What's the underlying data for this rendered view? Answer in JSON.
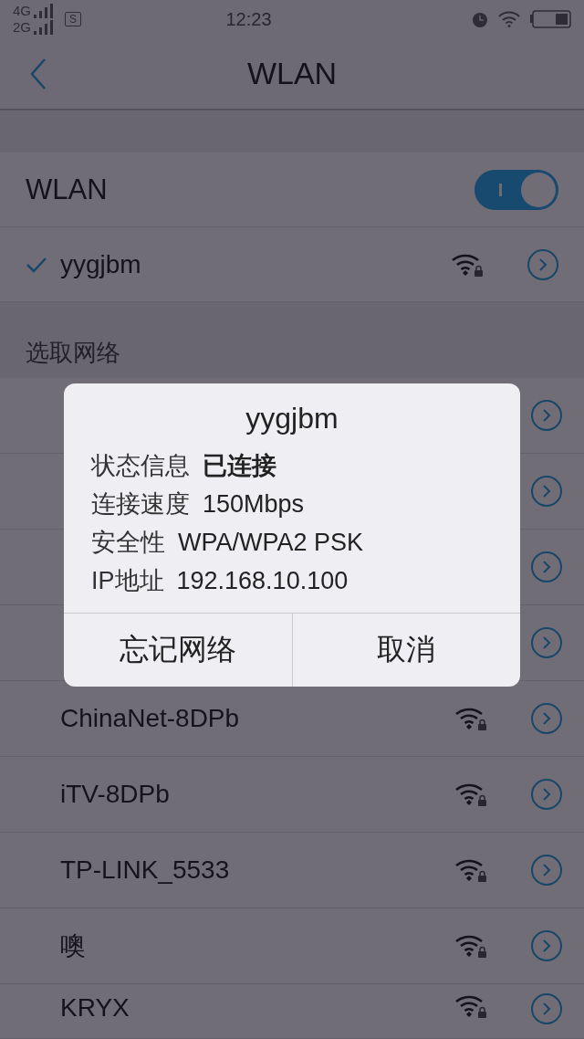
{
  "status_bar": {
    "network_top": "4G",
    "network_bottom": "2G",
    "sim_label": "S",
    "time": "12:23"
  },
  "header": {
    "title": "WLAN"
  },
  "wlan_toggle": {
    "label": "WLAN",
    "on": true
  },
  "connected": {
    "name": "yygjbm",
    "checked": true
  },
  "section_title": "选取网络",
  "networks": [
    {
      "kind": "covered"
    },
    {
      "kind": "covered"
    },
    {
      "kind": "covered"
    },
    {
      "kind": "covered"
    },
    {
      "kind": "visible",
      "name": "ChinaNet-8DPb"
    },
    {
      "kind": "visible",
      "name": "iTV-8DPb"
    },
    {
      "kind": "visible",
      "name": "TP-LINK_5533"
    },
    {
      "kind": "visible",
      "name": "噢"
    },
    {
      "kind": "visible",
      "name": "KRYX"
    }
  ],
  "dialog": {
    "title": "yygjbm",
    "info": [
      {
        "label": "状态信息",
        "value": "已连接",
        "kind": "bold"
      },
      {
        "label": "连接速度",
        "value": "150Mbps",
        "kind": "plain"
      },
      {
        "label": "安全性",
        "value": "WPA/WPA2 PSK",
        "kind": "plain"
      },
      {
        "label": "IP地址",
        "value": "192.168.10.100",
        "kind": "plain"
      }
    ],
    "buttons": [
      "忘记网络",
      "取消"
    ]
  }
}
